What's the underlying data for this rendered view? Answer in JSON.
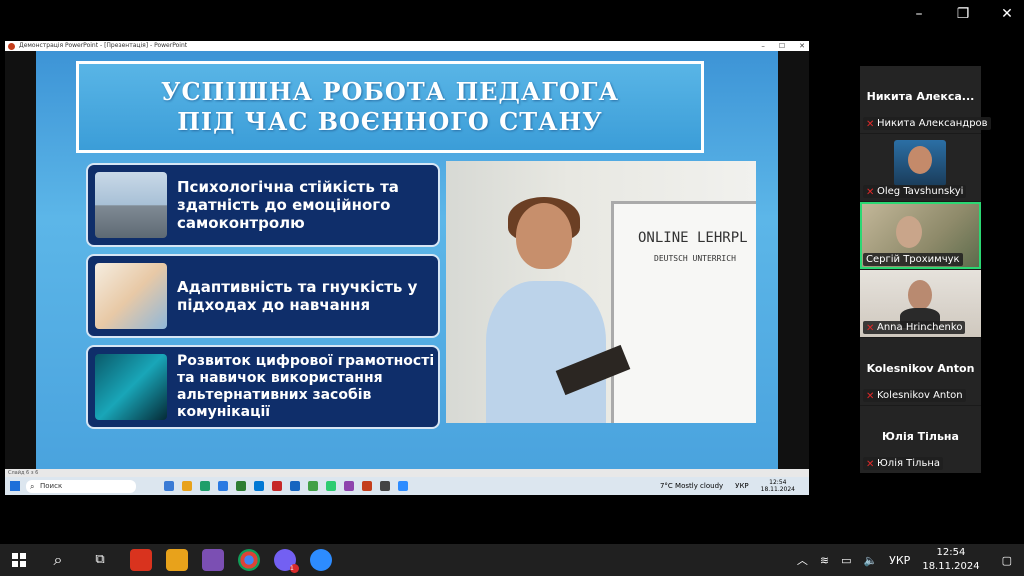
{
  "window": {
    "controls": [
      "–",
      "❐",
      "✕"
    ]
  },
  "powerpoint": {
    "title_bar": "Демонстрація PowerPoint - [Презентація] - PowerPoint",
    "slide_status": "Слайд 6 з 6",
    "slide": {
      "title_line1": "УСПІШНА РОБОТА ПЕДАГОГА",
      "title_line2": "ПІД ЧАС ВОЄННОГО СТАНУ",
      "cards": [
        "Психологічна стійкість та здатність до емоційного самоконтролю",
        "Адаптивність та гнучкість у підходах до навчання",
        "Розвиток цифрової грамотності та навичок використання альтернативних засобів комунікації"
      ],
      "board_lines": [
        "ONLINE LEHRPL",
        "DEUTSCH UNTERRICH"
      ]
    }
  },
  "inner_taskbar": {
    "search": "Поиск",
    "weather": "7°C  Mostly cloudy",
    "lang": "УКР",
    "time": "12:54",
    "date": "18.11.2024"
  },
  "participants": [
    {
      "big": "Никита  Алекса...",
      "label": "Никита Александров"
    },
    {
      "big": "",
      "label": "Oleg Tavshunskyi"
    },
    {
      "big": "",
      "label": "Сергій Трохимчук"
    },
    {
      "big": "",
      "label": "Anna Hrinchenko"
    },
    {
      "big": "Kolesnikov Anton",
      "label": "Kolesnikov Anton"
    },
    {
      "big": "Юлія Тільна",
      "label": "Юлія Тільна"
    }
  ],
  "taskbar": {
    "lang": "УКР",
    "time": "12:54",
    "date": "18.11.2024",
    "viber_badge": "1"
  },
  "colors": {
    "slide_blue": "#4aa3de",
    "card_navy": "#0f2e6a",
    "active_speaker": "#2bd873"
  }
}
